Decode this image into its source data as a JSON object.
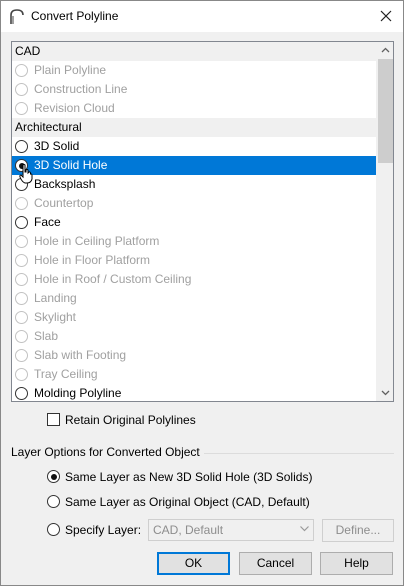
{
  "window": {
    "title": "Convert Polyline"
  },
  "list": {
    "rows": [
      {
        "type": "header",
        "label": "CAD"
      },
      {
        "type": "item",
        "label": "Plain Polyline",
        "disabled": true,
        "selected": false,
        "checked": false
      },
      {
        "type": "item",
        "label": "Construction Line",
        "disabled": true,
        "selected": false,
        "checked": false
      },
      {
        "type": "item",
        "label": "Revision Cloud",
        "disabled": true,
        "selected": false,
        "checked": false
      },
      {
        "type": "header",
        "label": "Architectural"
      },
      {
        "type": "item",
        "label": "3D Solid",
        "disabled": false,
        "selected": false,
        "checked": false
      },
      {
        "type": "item",
        "label": "3D Solid Hole",
        "disabled": false,
        "selected": true,
        "checked": true
      },
      {
        "type": "item",
        "label": "Backsplash",
        "disabled": false,
        "selected": false,
        "checked": false
      },
      {
        "type": "item",
        "label": "Countertop",
        "disabled": true,
        "selected": false,
        "checked": false
      },
      {
        "type": "item",
        "label": "Face",
        "disabled": false,
        "selected": false,
        "checked": false
      },
      {
        "type": "item",
        "label": "Hole in Ceiling Platform",
        "disabled": true,
        "selected": false,
        "checked": false
      },
      {
        "type": "item",
        "label": "Hole in Floor Platform",
        "disabled": true,
        "selected": false,
        "checked": false
      },
      {
        "type": "item",
        "label": "Hole in Roof / Custom Ceiling",
        "disabled": true,
        "selected": false,
        "checked": false
      },
      {
        "type": "item",
        "label": "Landing",
        "disabled": true,
        "selected": false,
        "checked": false
      },
      {
        "type": "item",
        "label": "Skylight",
        "disabled": true,
        "selected": false,
        "checked": false
      },
      {
        "type": "item",
        "label": "Slab",
        "disabled": true,
        "selected": false,
        "checked": false
      },
      {
        "type": "item",
        "label": "Slab with Footing",
        "disabled": true,
        "selected": false,
        "checked": false
      },
      {
        "type": "item",
        "label": "Tray Ceiling",
        "disabled": true,
        "selected": false,
        "checked": false
      },
      {
        "type": "item",
        "label": "Molding Polyline",
        "disabled": false,
        "selected": false,
        "checked": false
      }
    ]
  },
  "retain": {
    "label": "Retain Original Polylines",
    "checked": false
  },
  "layer_options": {
    "title": "Layer Options for Converted Object",
    "option1": "Same Layer as New 3D Solid Hole (3D Solids)",
    "option2": "Same Layer as Original Object (CAD,  Default)",
    "option3": "Specify Layer:",
    "selected_option": 1,
    "layer_select_value": "CAD,  Default",
    "define_label": "Define..."
  },
  "buttons": {
    "ok": "OK",
    "cancel": "Cancel",
    "help": "Help"
  },
  "colors": {
    "selection": "#0078d7",
    "disabled_text": "#a0a0a0"
  }
}
